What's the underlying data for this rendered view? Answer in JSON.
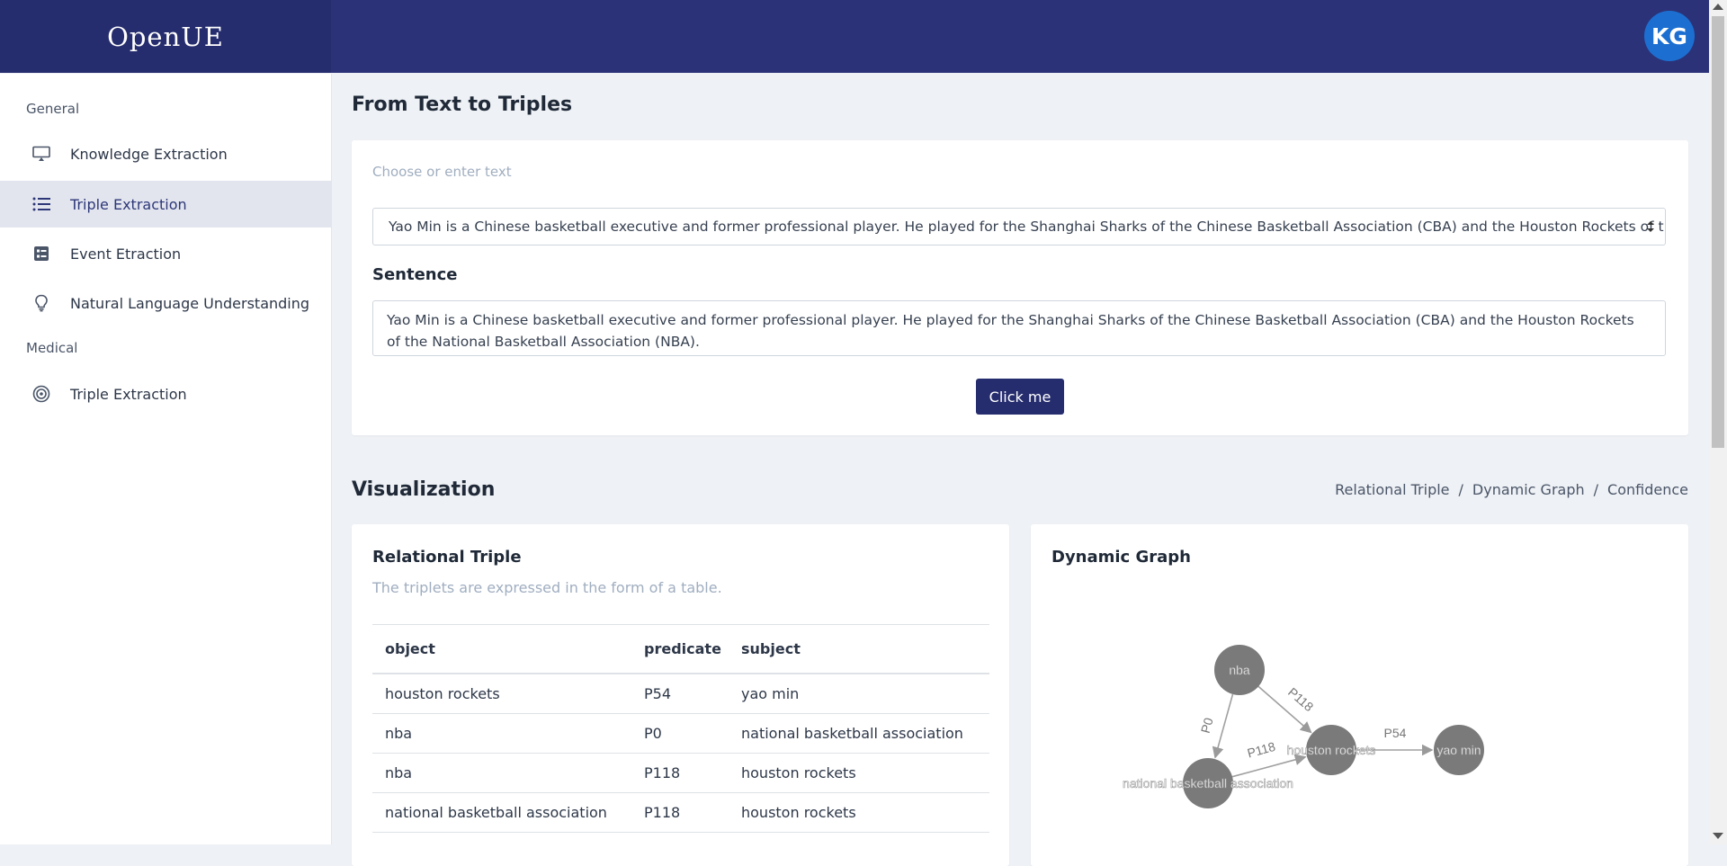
{
  "app": {
    "brand": "OpenUE",
    "avatar_text": "KG"
  },
  "sidebar": {
    "sections": [
      {
        "label": "General"
      },
      {
        "label": "Medical"
      }
    ],
    "items": [
      {
        "label": "Knowledge Extraction",
        "icon": "monitor-icon"
      },
      {
        "label": "Triple Extraction",
        "icon": "list-icon",
        "active": true
      },
      {
        "label": "Event Etraction",
        "icon": "checklist-icon"
      },
      {
        "label": "Natural Language Understanding",
        "icon": "lightbulb-icon"
      },
      {
        "label": "Triple Extraction",
        "icon": "target-icon"
      }
    ]
  },
  "main": {
    "title": "From Text to Triples",
    "choose_label": "Choose or enter text",
    "selected_text": "Yao Min is a Chinese basketball executive and former professional player. He played for the Shanghai Sharks of the Chinese Basketball Association (CBA) and the Houston Rockets of the National Basketball Association (NBA).",
    "sentence_label": "Sentence",
    "sentence_value": "Yao Min is a Chinese basketball executive and former professional player. He played for the Shanghai Sharks of the Chinese Basketball Association (CBA) and the Houston Rockets of the National Basketball Association (NBA).",
    "button_label": "Click me"
  },
  "visualization": {
    "title": "Visualization",
    "breadcrumb": [
      "Relational Triple",
      "Dynamic Graph",
      "Confidence"
    ],
    "relational": {
      "title": "Relational Triple",
      "subtitle": "The triplets are expressed in the form of a table.",
      "columns": [
        "object",
        "predicate",
        "subject"
      ],
      "rows": [
        [
          "houston rockets",
          "P54",
          "yao min"
        ],
        [
          "nba",
          "P0",
          "national basketball association"
        ],
        [
          "nba",
          "P118",
          "houston rockets"
        ],
        [
          "national basketball association",
          "P118",
          "houston rockets"
        ]
      ]
    },
    "graph": {
      "title": "Dynamic Graph",
      "nodes": [
        "nba",
        "national basketball association",
        "houston rockets",
        "yao min"
      ],
      "edges": [
        {
          "label": "P0",
          "from": "nba",
          "to": "national basketball association"
        },
        {
          "label": "P118",
          "from": "nba",
          "to": "houston rockets"
        },
        {
          "label": "P118",
          "from": "national basketball association",
          "to": "houston rockets"
        },
        {
          "label": "P54",
          "from": "houston rockets",
          "to": "yao min"
        }
      ]
    }
  },
  "colors": {
    "header": "#2b3278",
    "brand_bg": "#262d6e",
    "button": "#262d6e",
    "node": "#7a7a7a"
  }
}
